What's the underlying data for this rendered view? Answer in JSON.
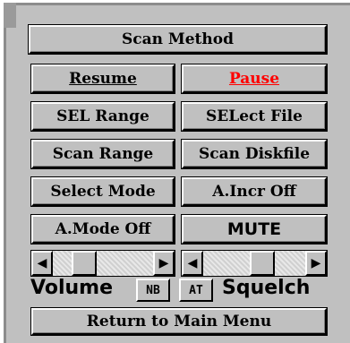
{
  "scan_method": {
    "label": "Scan Method"
  },
  "buttons": {
    "resume": "Resume",
    "pause": "Pause",
    "sel_range": "SEL Range",
    "select_file": "SELect File",
    "scan_range": "Scan Range",
    "scan_diskfile": "Scan Diskfile",
    "select_mode": "Select Mode",
    "a_incr_off": "A.Incr Off",
    "a_mode_off": "A.Mode Off",
    "mute": "MUTE"
  },
  "controls": {
    "volume_label": "Volume",
    "nb_label": "NB",
    "at_label": "AT",
    "squelch_label": "Squelch",
    "volume_level": 0.25,
    "squelch_level": 0.6
  },
  "footer": {
    "return_label": "Return to Main Menu"
  },
  "icons": {
    "left_arrow": "◀",
    "right_arrow": "▶"
  },
  "colors": {
    "panel": "#c0c0c0",
    "pause_text": "#ff0000"
  }
}
